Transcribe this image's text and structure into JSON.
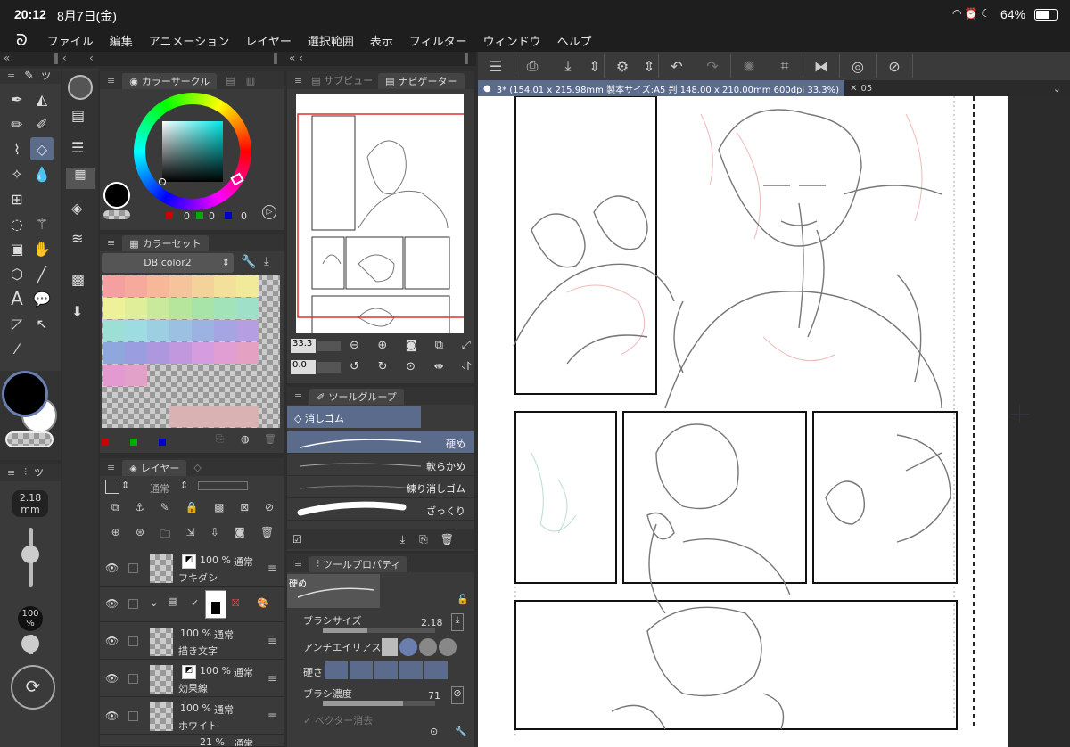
{
  "status_bar": {
    "time": "20:12",
    "date": "8月7日(金)",
    "battery": "64%"
  },
  "menu": {
    "items": [
      "ファイル",
      "編集",
      "アニメーション",
      "レイヤー",
      "選択範囲",
      "表示",
      "フィルター",
      "ウィンドウ",
      "ヘルプ"
    ]
  },
  "tool_panel": {
    "tab_label": "ツ"
  },
  "sub_tool_panel": {
    "tab_label": "ツ",
    "brush_size": "2.18",
    "brush_unit": "mm",
    "opacity": "100",
    "opacity_unit": "%"
  },
  "color_circle": {
    "title": "カラーサークル",
    "r": "0",
    "g": "0",
    "b": "0"
  },
  "color_set": {
    "title": "カラーセット",
    "set_name": "DB color2",
    "rows": [
      [
        "#f4a0a0",
        "#f5aa9c",
        "#f7b89a",
        "#f5c49a",
        "#f3d39a",
        "#f3e09a",
        "#f0ea9a"
      ],
      [
        "#eef09a",
        "#e0ee9a",
        "#c9ea9a",
        "#b5e69c",
        "#a8e4a8",
        "#a3e3b9",
        "#9fe0c8"
      ],
      [
        "#9ddfd5",
        "#9ddce0",
        "#9ccfe2",
        "#9cc0e2",
        "#9cb2e3",
        "#a6a5e3",
        "#b59fe2"
      ],
      [
        "#8ea7dc",
        "#9a9ee0",
        "#ad98e0",
        "#c197de",
        "#d69ce0",
        "#e09ed3",
        "#e4a1c1"
      ],
      [
        "#e29ad1",
        "#e1a1c9"
      ]
    ],
    "extra_swatches": [
      "#d9b3b3",
      "#d9b3b3",
      "#d9b3b3",
      "#d9b3b3"
    ]
  },
  "layer_panel": {
    "title": "レイヤー",
    "blend_mode": "通常",
    "layers": [
      {
        "opacity": "100 %",
        "mode": "通常",
        "name": "フキダシ"
      },
      {
        "opacity": "",
        "mode": "",
        "name": ""
      },
      {
        "opacity": "100 %",
        "mode": "通常",
        "name": "描き文字"
      },
      {
        "opacity": "100 %",
        "mode": "通常",
        "name": "効果線"
      },
      {
        "opacity": "100 %",
        "mode": "通常",
        "name": "ホワイト"
      },
      {
        "opacity": "21 %",
        "mode": "通常",
        "name": ""
      }
    ]
  },
  "navigator": {
    "tab_sub": "サブビュー",
    "tab_nav": "ナビゲーター",
    "zoom": "33.3",
    "rotation": "0.0"
  },
  "tool_group": {
    "title": "ツールグループ",
    "selected": "消しゴム",
    "brushes": [
      "硬め",
      "軟らかめ",
      "練り消しゴム",
      "ざっくり"
    ]
  },
  "tool_property": {
    "title": "ツールプロパティ",
    "preview_label": "硬め",
    "brush_size_label": "ブラシサイズ",
    "brush_size_value": "2.18",
    "antialias_label": "アンチエイリアス",
    "hardness_label": "硬さ",
    "density_label": "ブラシ濃度",
    "density_value": "71",
    "vector_erase_label": "ベクター消去"
  },
  "document": {
    "tab_title": "3* (154.01 x 215.98mm 製本サイズ:A5 判 148.00 x 210.00mm 600dpi 33.3%)",
    "tab_other": "05"
  },
  "colors": {
    "accent_panel": "#3a3a3a",
    "selected_tool": "#5b6b8c",
    "canvas_bg": "#ffffff",
    "frame_red": "#e03030"
  }
}
